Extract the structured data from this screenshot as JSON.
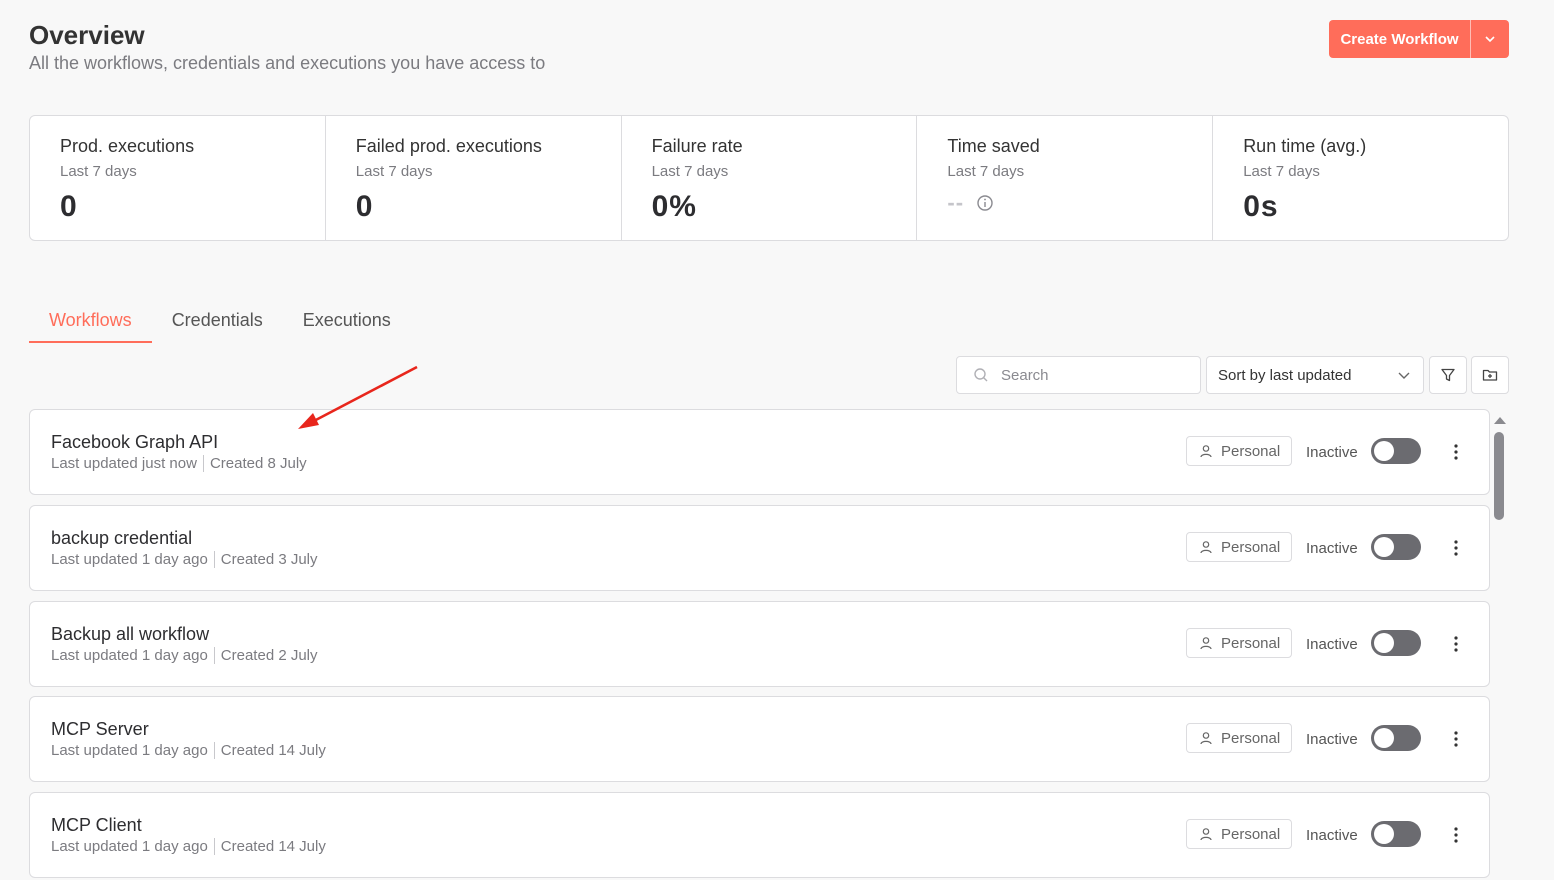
{
  "header": {
    "title": "Overview",
    "subtitle": "All the workflows, credentials and executions you have access to",
    "create_button_label": "Create Workflow",
    "accent_color": "#ff6d5a"
  },
  "stats": [
    {
      "label": "Prod. executions",
      "period": "Last 7 days",
      "value": "0"
    },
    {
      "label": "Failed prod. executions",
      "period": "Last 7 days",
      "value": "0"
    },
    {
      "label": "Failure rate",
      "period": "Last 7 days",
      "value": "0%"
    },
    {
      "label": "Time saved",
      "period": "Last 7 days",
      "value": "--"
    },
    {
      "label": "Run time (avg.)",
      "period": "Last 7 days",
      "value": "0s"
    }
  ],
  "tabs": [
    {
      "label": "Workflows",
      "active": true
    },
    {
      "label": "Credentials",
      "active": false
    },
    {
      "label": "Executions",
      "active": false
    }
  ],
  "toolbar": {
    "search_placeholder": "Search",
    "sort_value": "Sort by last updated",
    "filter_icon": "filter-icon",
    "folder_icon": "add-folder-icon"
  },
  "workflows": [
    {
      "name": "Facebook Graph API",
      "updated": "Last updated just now",
      "created": "Created 8 July",
      "owner": "Personal",
      "status": "Inactive"
    },
    {
      "name": "backup credential",
      "updated": "Last updated 1 day ago",
      "created": "Created 3 July",
      "owner": "Personal",
      "status": "Inactive"
    },
    {
      "name": "Backup all workflow",
      "updated": "Last updated 1 day ago",
      "created": "Created 2 July",
      "owner": "Personal",
      "status": "Inactive"
    },
    {
      "name": "MCP Server",
      "updated": "Last updated 1 day ago",
      "created": "Created 14 July",
      "owner": "Personal",
      "status": "Inactive"
    },
    {
      "name": "MCP Client",
      "updated": "Last updated 1 day ago",
      "created": "Created 14 July",
      "owner": "Personal",
      "status": "Inactive"
    }
  ]
}
